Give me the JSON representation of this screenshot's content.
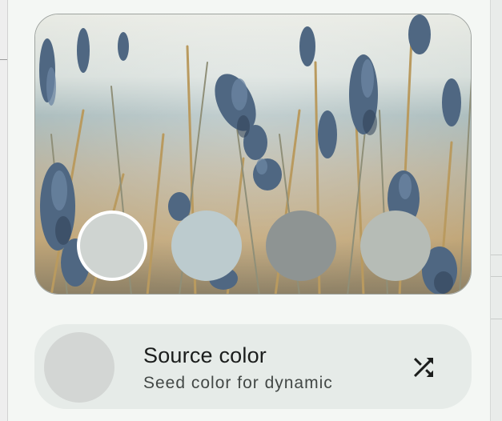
{
  "wallpaper": {
    "swatches": [
      {
        "color": "#cfd4d1",
        "selected": true
      },
      {
        "color": "#bccbce",
        "selected": false
      },
      {
        "color": "#8e9493",
        "selected": false
      },
      {
        "color": "#b6bcb6",
        "selected": false
      }
    ]
  },
  "source_color": {
    "title": "Source color",
    "subtitle": "Seed color for dynamic",
    "seed_color": "#d3d6d4",
    "shuffle_icon": "shuffle-icon"
  }
}
